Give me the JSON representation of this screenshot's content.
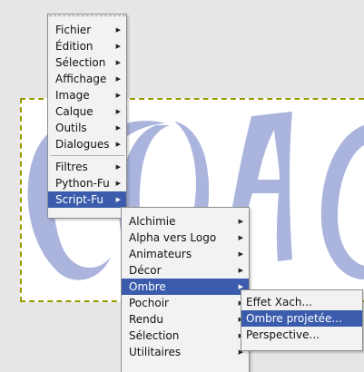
{
  "colors": {
    "accent": "#3b5cad",
    "menu_bg": "#f2f2f2",
    "artwork": "#aab4dd",
    "selection_border": "#9a9a00"
  },
  "main_menu": {
    "items": [
      {
        "label": "Fichier"
      },
      {
        "label": "Édition"
      },
      {
        "label": "Sélection"
      },
      {
        "label": "Affichage"
      },
      {
        "label": "Image"
      },
      {
        "label": "Calque"
      },
      {
        "label": "Outils"
      },
      {
        "label": "Dialogues"
      },
      {
        "label": "Filtres"
      },
      {
        "label": "Python-Fu"
      },
      {
        "label": "Script-Fu"
      }
    ]
  },
  "script_fu_menu": {
    "items": [
      {
        "label": "Alchimie"
      },
      {
        "label": "Alpha vers Logo"
      },
      {
        "label": "Animateurs"
      },
      {
        "label": "Décor"
      },
      {
        "label": "Ombre"
      },
      {
        "label": "Pochoir"
      },
      {
        "label": "Rendu"
      },
      {
        "label": "Sélection"
      },
      {
        "label": "Utilitaires"
      }
    ]
  },
  "ombre_menu": {
    "items": [
      {
        "label": "Effet Xach..."
      },
      {
        "label": "Ombre projetée..."
      },
      {
        "label": "Perspective..."
      }
    ]
  }
}
